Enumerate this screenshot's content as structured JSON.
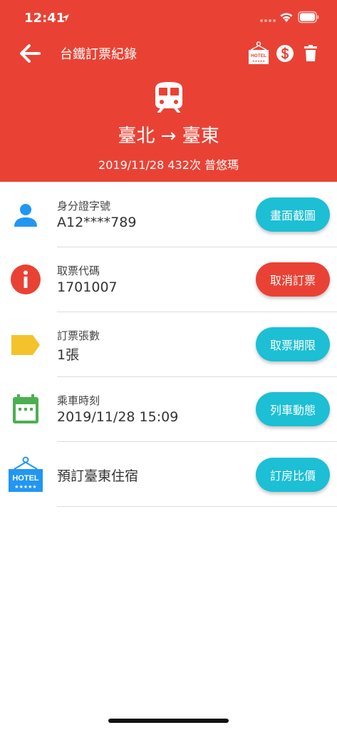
{
  "status_bar": {
    "time": "12:41"
  },
  "nav": {
    "title": "台鐵訂票紀錄"
  },
  "hotel_badge": {
    "top": "HOTEL",
    "stars": "★★★★★"
  },
  "trip": {
    "route": "臺北 → 臺東",
    "info": "2019/11/28 432次 普悠瑪"
  },
  "rows": [
    {
      "label": "身分證字號",
      "value": "A12****789",
      "button": "畫面截圖"
    },
    {
      "label": "取票代碼",
      "value": "1701007",
      "button": "取消訂票"
    },
    {
      "label": "訂票張數",
      "value": "1張",
      "button": "取票期限"
    },
    {
      "label": "乘車時刻",
      "value": "2019/11/28 15:09",
      "button": "列車動態"
    },
    {
      "value": "預訂臺東住宿",
      "button": "訂房比價"
    }
  ],
  "colors": {
    "header": "#e94234",
    "cyan_button": "#1cbfd4",
    "red_button": "#e94234",
    "person_icon": "#2196f3",
    "info_icon": "#e94234",
    "tag_icon": "#f4c22b",
    "calendar_icon": "#4caf50",
    "hotel_icon": "#2196f3"
  },
  "icons": [
    "location-arrow-icon",
    "signal-icon",
    "wifi-icon",
    "battery-icon",
    "back-arrow-icon",
    "hotel-icon",
    "dollar-icon",
    "trash-icon",
    "train-icon",
    "person-icon",
    "info-icon",
    "tag-icon",
    "calendar-icon",
    "hotel-sign-icon"
  ]
}
